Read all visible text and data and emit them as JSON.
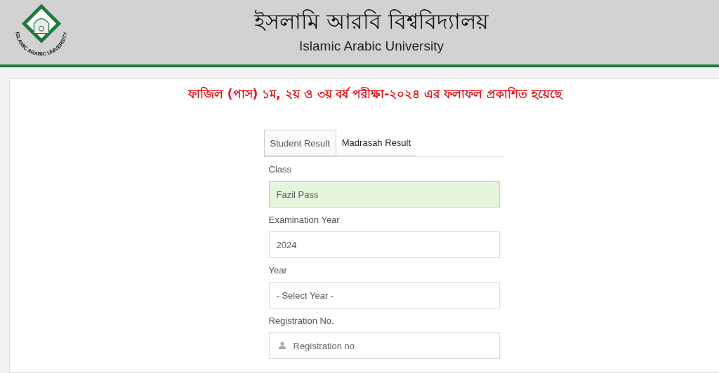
{
  "header": {
    "title_bn": "ইসলামি আরবি বিশ্ববিদ্যালয়",
    "title_en": "Islamic Arabic University",
    "logo_text": "ISLAMIC ARABIC UNIVERSITY"
  },
  "notice": "ফাজিল (পাস) ১ম, ২য় ও ৩য় বর্ষ পরীক্ষা-২০২৪ এর ফলাফল প্রকাশিত হয়েছে",
  "tabs": [
    {
      "label": "Student Result",
      "selected": true
    },
    {
      "label": "Madrasah Result",
      "selected": false
    }
  ],
  "form": {
    "fields": [
      {
        "label": "Class",
        "kind": "select",
        "value": "Fazil Pass",
        "valid": true
      },
      {
        "label": "Examination Year",
        "kind": "select",
        "value": "2024",
        "valid": false
      },
      {
        "label": "Year",
        "kind": "select",
        "value": "- Select Year -",
        "valid": false
      },
      {
        "label": "Registration No.",
        "kind": "text",
        "placeholder": "Registration no",
        "valid": false
      }
    ]
  }
}
